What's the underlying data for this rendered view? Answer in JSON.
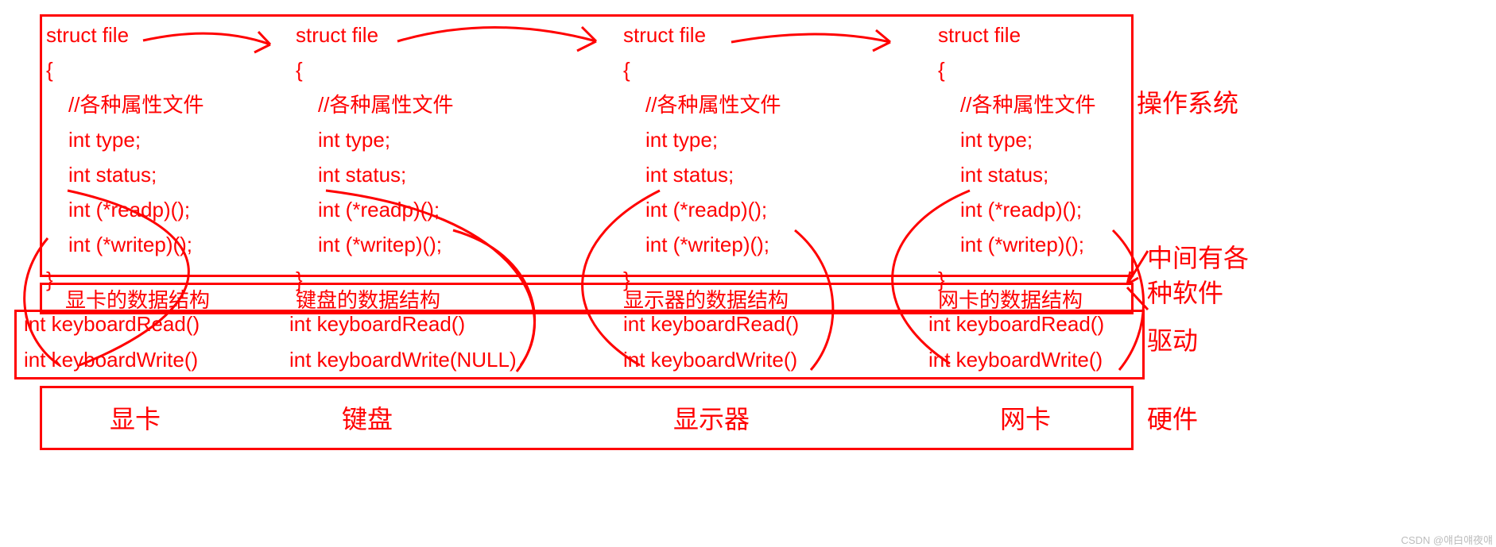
{
  "structs": [
    {
      "header": "struct file",
      "open": "{",
      "comment": "//各种属性文件",
      "l1": "int type;",
      "l2": "int status;",
      "l3": "int (*readp)();",
      "l4": "int (*writep)();",
      "close": "}"
    },
    {
      "header": "struct file",
      "open": "{",
      "comment": "//各种属性文件",
      "l1": "int type;",
      "l2": "int status;",
      "l3": "int (*readp)();",
      "l4": "int (*writep)();",
      "close": "}"
    },
    {
      "header": "struct file",
      "open": "{",
      "comment": "//各种属性文件",
      "l1": "int type;",
      "l2": "int status;",
      "l3": "int (*readp)();",
      "l4": "int (*writep)();",
      "close": "}"
    },
    {
      "header": "struct file",
      "open": "{",
      "comment": "//各种属性文件",
      "l1": "int type;",
      "l2": "int status;",
      "l3": "int (*readp)();",
      "l4": "int (*writep)();",
      "close": "}"
    }
  ],
  "dataStructs": {
    "d0": "显卡的数据结构",
    "d1": "键盘的数据结构",
    "d2": "显示器的数据结构",
    "d3": "网卡的数据结构"
  },
  "driverFns": {
    "r0": "int keyboardRead()",
    "w0": "int keyboardWrite()",
    "r1": "int keyboardRead()",
    "w1": "int keyboardWrite(NULL)",
    "r2": "int keyboardRead()",
    "w2": "int keyboardWrite()",
    "r3": "int keyboardRead()",
    "w3": "int keyboardWrite()"
  },
  "hardware": {
    "h0": "显卡",
    "h1": "键盘",
    "h2": "显示器",
    "h3": "网卡"
  },
  "sideLabels": {
    "os": "操作系统",
    "mid1": "中间有各",
    "mid2": "种软件",
    "drv": "驱动",
    "hw": "硬件"
  },
  "watermark": "CSDN @얘白얘夜얘"
}
